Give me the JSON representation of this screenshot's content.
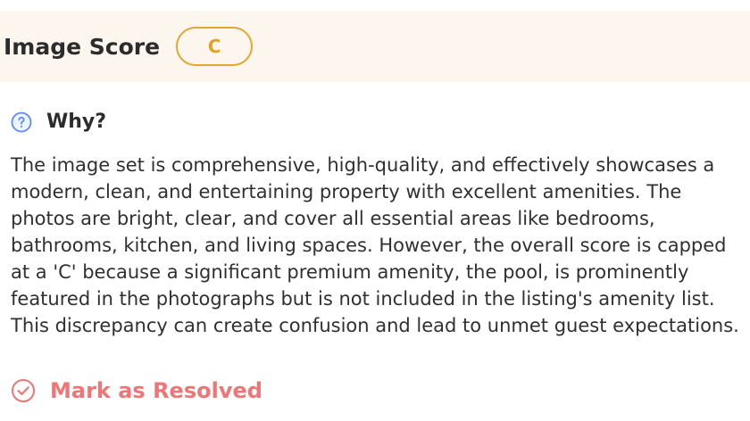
{
  "score": {
    "title": "Image Score",
    "grade": "C",
    "badge_color": "#e3a72f",
    "header_bg": "#fcf6ee"
  },
  "why": {
    "icon": "question-circle-icon",
    "label": "Why?",
    "explanation": "The image set is comprehensive, high-quality, and effectively showcases a modern, clean, and entertaining property with excellent amenities. The photos are bright, clear, and cover all essential areas like bedrooms, bathrooms, kitchen, and living spaces. However, the overall score is capped at a 'C' because a significant premium amenity, the pool, is prominently featured in the photographs but is not included in the listing's amenity list. This discrepancy can create confusion and lead to unmet guest expectations."
  },
  "resolve": {
    "icon": "check-circle-icon",
    "label": "Mark as Resolved",
    "color": "#ef7676"
  }
}
